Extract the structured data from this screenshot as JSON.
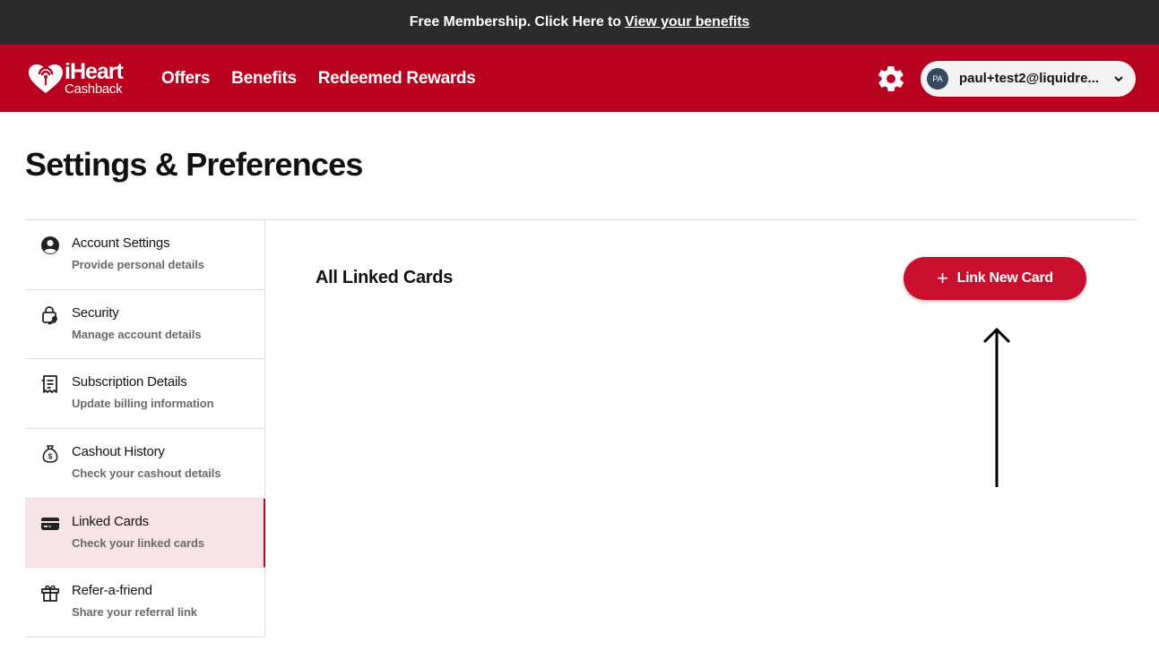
{
  "promo_bar": {
    "text": "Free Membership. Click Here to",
    "link": "View your benefits"
  },
  "header": {
    "logo": {
      "brand": "iHeart",
      "sub": "Cashback",
      "icon": "iheart-logo-icon"
    },
    "nav": [
      {
        "label": "Offers"
      },
      {
        "label": "Benefits"
      },
      {
        "label": "Redeemed Rewards"
      }
    ],
    "settings_icon": "gear-icon",
    "user": {
      "initials": "PA",
      "email": "paul+test2@liquidre..."
    }
  },
  "page": {
    "title": "Settings & Preferences"
  },
  "sidebar": {
    "items": [
      {
        "label": "Account Settings",
        "desc": "Provide personal details",
        "icon": "user-circle-icon"
      },
      {
        "label": "Security",
        "desc": "Manage account details",
        "icon": "lock-key-icon"
      },
      {
        "label": "Subscription Details",
        "desc": "Update billing information",
        "icon": "receipt-icon"
      },
      {
        "label": "Cashout History",
        "desc": "Check your cashout details",
        "icon": "money-bag-icon"
      },
      {
        "label": "Linked Cards",
        "desc": "Check your linked cards",
        "icon": "credit-card-icon",
        "active": true
      },
      {
        "label": "Refer-a-friend",
        "desc": "Share your referral link",
        "icon": "gift-icon"
      }
    ]
  },
  "main": {
    "title": "All Linked Cards",
    "link_button": {
      "label": "Link New Card",
      "icon": "plus-icon"
    }
  },
  "colors": {
    "brand_red": "#b8001f",
    "button_red": "#c8102e",
    "promo_bg": "#2b2b2d",
    "active_bg": "#f8e3e7"
  }
}
